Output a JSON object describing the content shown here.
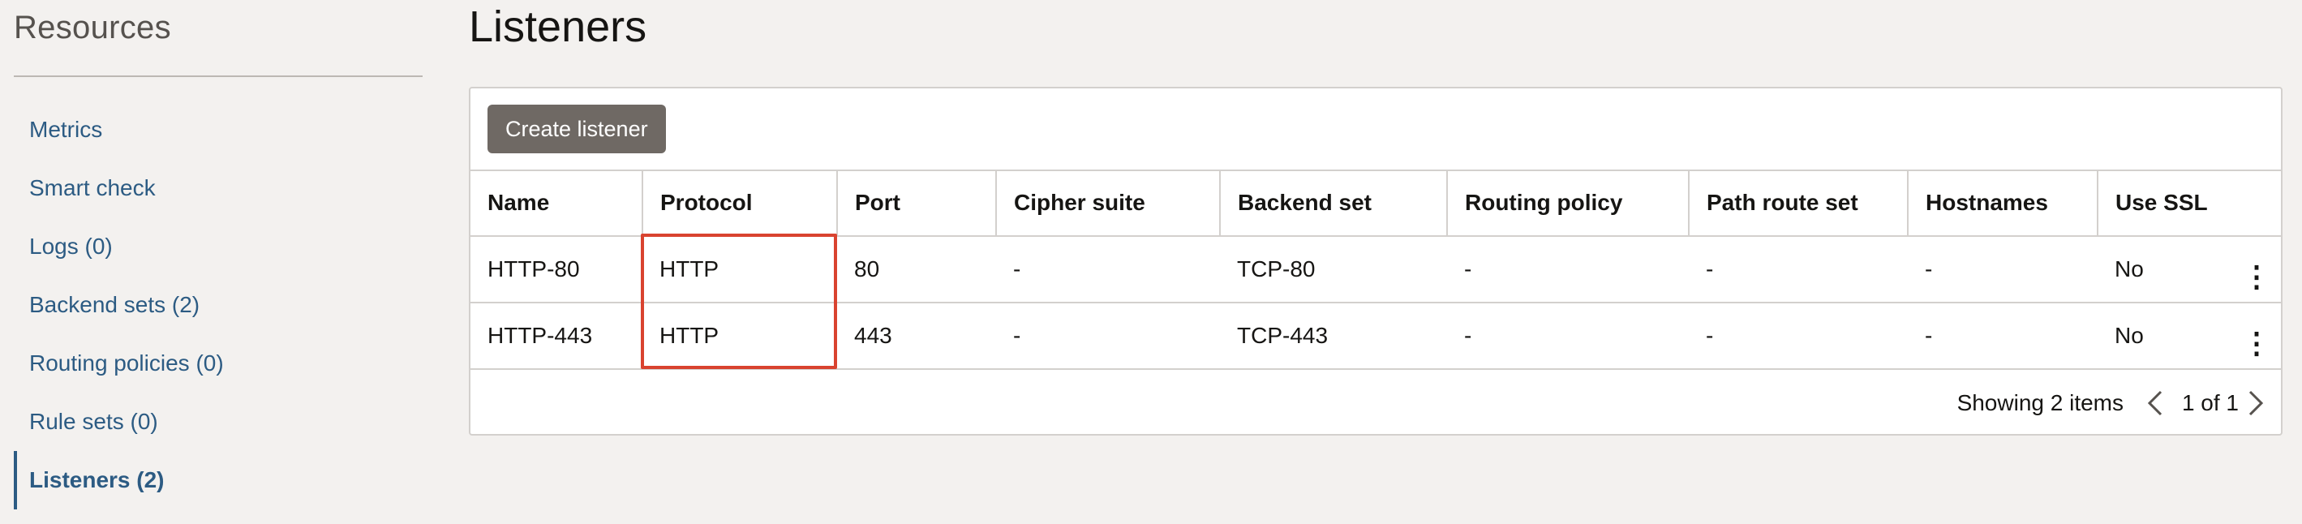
{
  "sidebar": {
    "title": "Resources",
    "items": [
      {
        "label": "Metrics"
      },
      {
        "label": "Smart check"
      },
      {
        "label": "Logs (0)"
      },
      {
        "label": "Backend sets (2)"
      },
      {
        "label": "Routing policies (0)"
      },
      {
        "label": "Rule sets (0)"
      },
      {
        "label": "Listeners (2)"
      }
    ],
    "active_item": "Listeners (2)"
  },
  "main": {
    "title": "Listeners",
    "create_button_label": "Create listener",
    "table": {
      "columns": [
        "Name",
        "Protocol",
        "Port",
        "Cipher suite",
        "Backend set",
        "Routing policy",
        "Path route set",
        "Hostnames",
        "Use SSL"
      ],
      "rows": [
        [
          "HTTP-80",
          "HTTP",
          "80",
          "-",
          "TCP-80",
          "-",
          "-",
          "-",
          "No"
        ],
        [
          "HTTP-443",
          "HTTP",
          "443",
          "-",
          "TCP-443",
          "-",
          "-",
          "-",
          "No"
        ]
      ],
      "row_action_icon": "kebab-menu-icon"
    },
    "pagination": {
      "showing": "Showing 2 items",
      "page": "1 of 1",
      "prev_icon": "chevron-left-icon",
      "next_icon": "chevron-right-icon"
    }
  },
  "colors": {
    "link": "#2c5b83",
    "button_bg": "#6f6964",
    "highlight": "#d9432f",
    "background": "#f3f1ef"
  }
}
